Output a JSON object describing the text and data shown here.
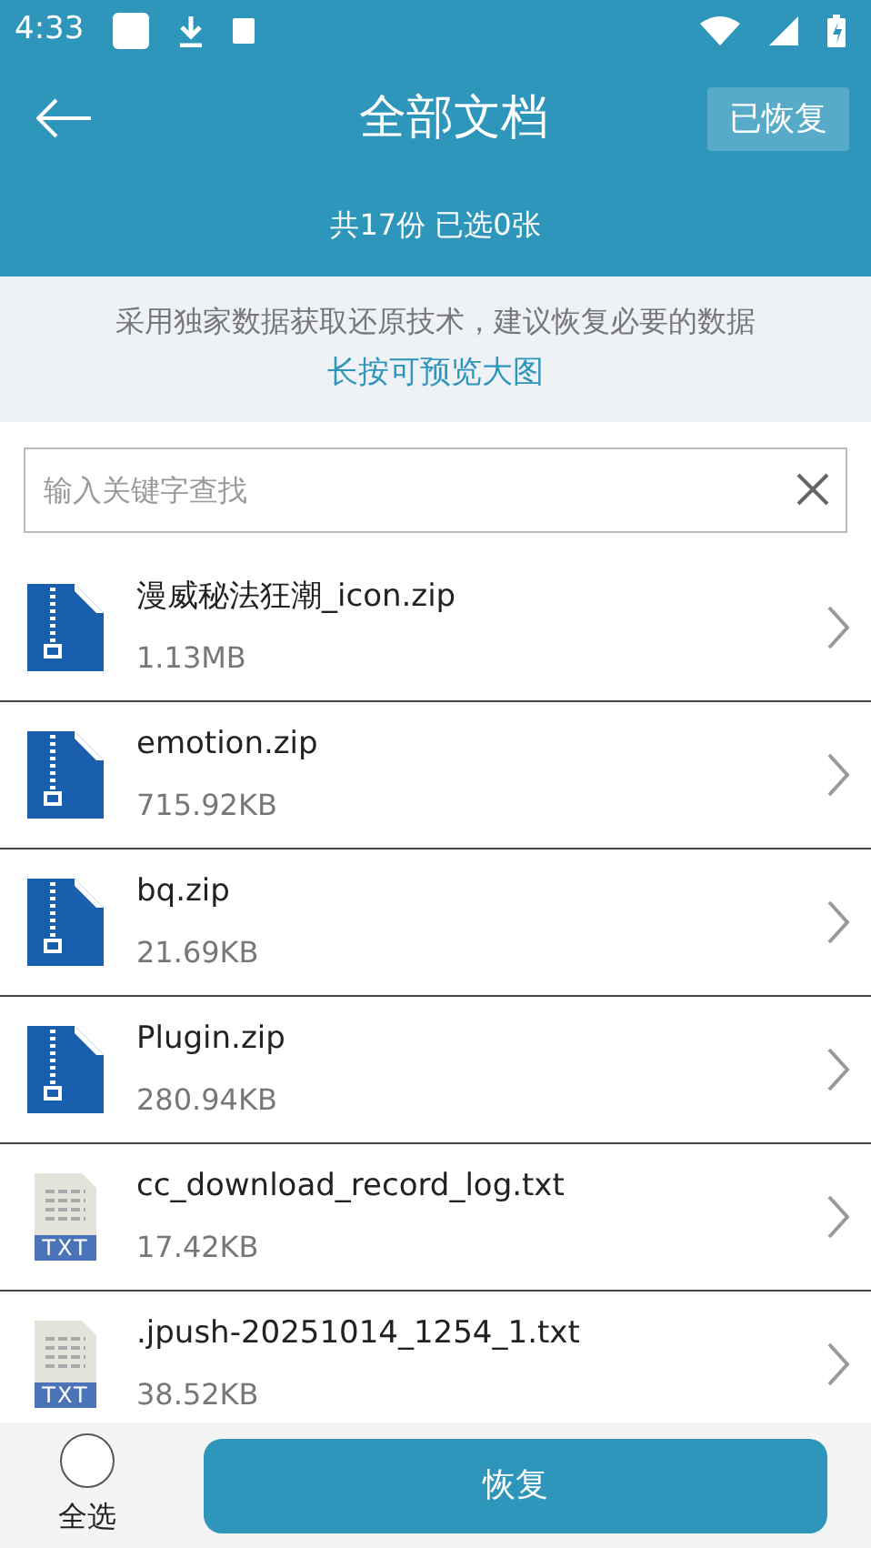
{
  "status_bar": {
    "time": "4:33"
  },
  "header": {
    "title": "全部文档",
    "action": "已恢复",
    "summary": "共17份 已选0张"
  },
  "notice": {
    "text": "采用独家数据获取还原技术，建议恢复必要的数据",
    "hint": "长按可预览大图"
  },
  "search": {
    "placeholder": "输入关键字查找"
  },
  "files": [
    {
      "kind": "zip",
      "name": "漫威秘法狂潮_icon.zip",
      "size": "1.13MB"
    },
    {
      "kind": "zip",
      "name": "emotion.zip",
      "size": "715.92KB"
    },
    {
      "kind": "zip",
      "name": "bq.zip",
      "size": "21.69KB"
    },
    {
      "kind": "zip",
      "name": "Plugin.zip",
      "size": "280.94KB"
    },
    {
      "kind": "txt",
      "name": "cc_download_record_log.txt",
      "size": "17.42KB",
      "badge": "TXT"
    },
    {
      "kind": "txt",
      "name": ".jpush-20251014_1254_1.txt",
      "size": "38.52KB",
      "badge": "TXT"
    }
  ],
  "footer": {
    "select_all": {
      "label": "全选",
      "checked": false
    },
    "restore": "恢复"
  }
}
